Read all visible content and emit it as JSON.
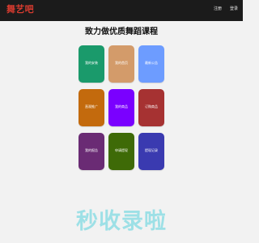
{
  "header": {
    "logo": "舞艺吧",
    "links": [
      {
        "label": "注册"
      },
      {
        "label": "登录"
      }
    ]
  },
  "main": {
    "title": "致力做优质舞蹈课程",
    "cards": [
      {
        "label": "我的安装",
        "color": "#1a9a6b"
      },
      {
        "label": "我的首页",
        "color": "#d39b6a"
      },
      {
        "label": "最新公告",
        "color": "#6d9cff"
      },
      {
        "label": "直观推广",
        "color": "#c36a0d"
      },
      {
        "label": "我的商品",
        "color": "#7a00ff"
      },
      {
        "label": "订购商品",
        "color": "#a63232"
      },
      {
        "label": "我的报告",
        "color": "#6a2b74"
      },
      {
        "label": "申请提现",
        "color": "#3e6a07"
      },
      {
        "label": "提现记录",
        "color": "#3a3ab0"
      }
    ]
  },
  "footer": {
    "banner": "秒收录啦"
  }
}
